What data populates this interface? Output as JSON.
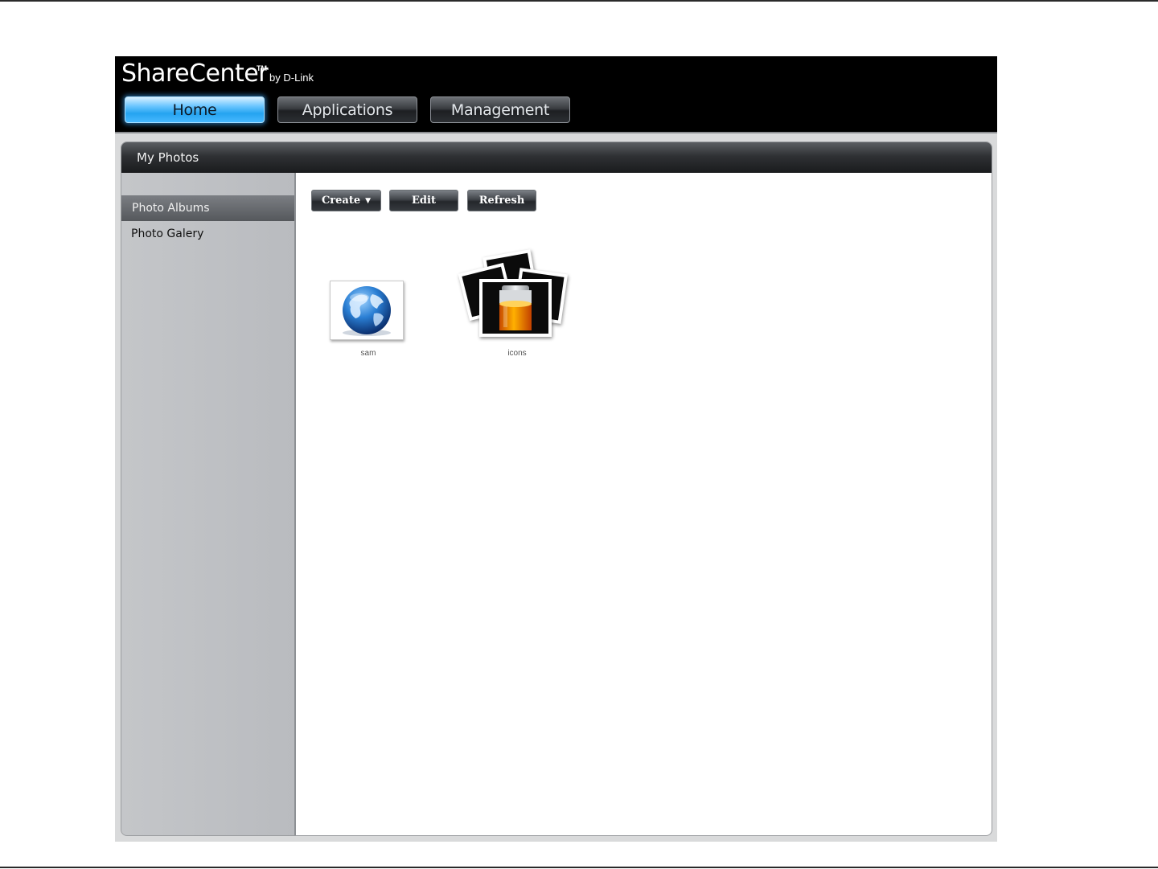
{
  "app": {
    "logo_main": "ShareCenter",
    "logo_tm": "TM",
    "logo_by": "by D-Link"
  },
  "nav": {
    "home": "Home",
    "applications": "Applications",
    "management": "Management"
  },
  "panel": {
    "title": "My Photos"
  },
  "sidebar": {
    "items": [
      {
        "label": "Photo Albums",
        "active": true
      },
      {
        "label": "Photo Galery",
        "active": false
      }
    ]
  },
  "toolbar": {
    "create": "Create",
    "create_caret": "▼",
    "edit": "Edit",
    "refresh": "Refresh"
  },
  "albums": [
    {
      "name": "sam",
      "icon": "globe-icon"
    },
    {
      "name": "icons",
      "icon": "battery-icon"
    }
  ],
  "colors": {
    "home_accent": "#25a4f0",
    "header_bg": "#000000",
    "sidebar_bg": "#c1c3c6"
  }
}
